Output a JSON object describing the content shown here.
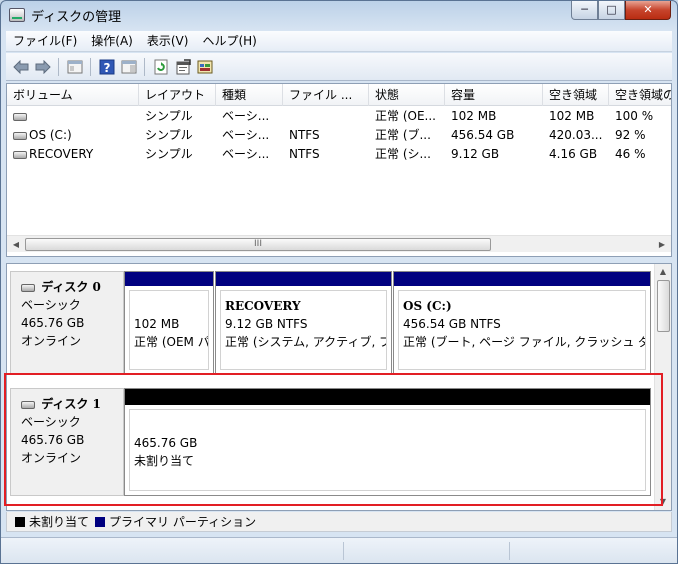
{
  "window": {
    "title": "ディスクの管理",
    "minimize_glyph": "─",
    "maximize_glyph": "□",
    "close_glyph": "✕"
  },
  "menu": [
    "ファイル(F)",
    "操作(A)",
    "表示(V)",
    "ヘルプ(H)"
  ],
  "toolbar": {
    "icons": [
      "back-arrow-icon",
      "forward-arrow-icon",
      "console-tree-icon",
      "help-icon",
      "pane-view-icon",
      "refresh-icon",
      "properties-icon",
      "disk-settings-icon"
    ]
  },
  "volume_list": {
    "columns": [
      "ボリューム",
      "レイアウト",
      "種類",
      "ファイル ...",
      "状態",
      "容量",
      "空き領域",
      "空き領域の"
    ],
    "rows": [
      [
        "",
        "シンプル",
        "ベーシ...",
        "",
        "正常 (OE...",
        "102 MB",
        "102 MB",
        "100 %"
      ],
      [
        "OS (C:)",
        "シンプル",
        "ベーシ...",
        "NTFS",
        "正常 (ブ...",
        "456.54 GB",
        "420.03...",
        "92 %"
      ],
      [
        "RECOVERY",
        "シンプル",
        "ベーシ...",
        "NTFS",
        "正常 (シ...",
        "9.12 GB",
        "4.16 GB",
        "46 %"
      ]
    ],
    "scroll_grip": "III"
  },
  "disks": [
    {
      "name": "ディスク 0",
      "type": "ベーシック",
      "size": "465.76 GB",
      "status": "オンライン",
      "partitions": [
        {
          "title": "",
          "lines": [
            "102 MB",
            "正常 (OEM パーティション)"
          ],
          "color": "#000080"
        },
        {
          "title": "RECOVERY",
          "lines": [
            "9.12 GB NTFS",
            "正常 (システム, アクティブ, プライマリ パーティション)"
          ],
          "color": "#000080"
        },
        {
          "title": "OS  (C:)",
          "lines": [
            "456.54 GB NTFS",
            "正常 (ブート, ページ ファイル, クラッシュ ダンプ, プライマリ パーティション)"
          ],
          "color": "#000080"
        }
      ]
    },
    {
      "name": "ディスク 1",
      "type": "ベーシック",
      "size": "465.76 GB",
      "status": "オンライン",
      "partitions": [
        {
          "title": "",
          "lines": [
            "465.76 GB",
            "未割り当て"
          ],
          "color": "#000000"
        }
      ]
    }
  ],
  "legend": [
    {
      "label": "未割り当て",
      "color": "#000000"
    },
    {
      "label": "プライマリ パーティション",
      "color": "#000080"
    }
  ],
  "highlight_color": "#e21e24"
}
